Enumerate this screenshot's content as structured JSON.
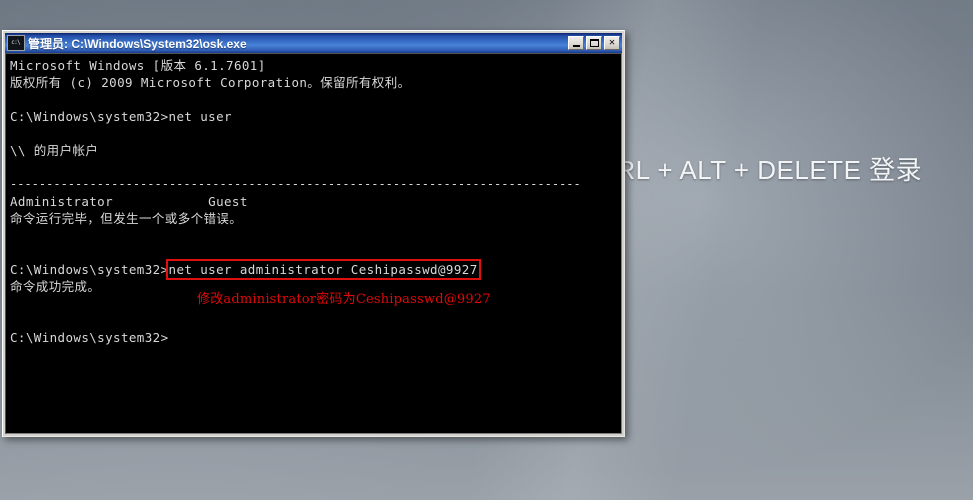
{
  "background": {
    "login_prompt": "TRL + ALT + DELETE 登录",
    "color": "#7c858f"
  },
  "window": {
    "title": "管理员: C:\\Windows\\System32\\osk.exe",
    "icon": "console-icon",
    "controls": {
      "minimize": "_",
      "maximize": "□",
      "close": "✕"
    }
  },
  "console": {
    "accent_red": "#e00808",
    "lines": [
      {
        "text": "Microsoft Windows [版本 6.1.7601]"
      },
      {
        "text": "版权所有 (c) 2009 Microsoft Corporation。保留所有权利。"
      },
      {
        "text": ""
      },
      {
        "text": "C:\\Windows\\system32>net user"
      },
      {
        "text": ""
      },
      {
        "text": "\\\\ 的用户帐户"
      },
      {
        "text": ""
      },
      {
        "text": "-------------------------------------------------------------------------------"
      },
      {
        "text": "Administrator            Guest"
      },
      {
        "text": "命令运行完毕，但发生一个或多个错误。"
      },
      {
        "text": ""
      },
      {
        "text": ""
      },
      {
        "prompt": "C:\\Windows\\system32>",
        "command": "net user administrator Ceshipasswd@9927",
        "highlight": true
      },
      {
        "text": "命令成功完成。"
      },
      {
        "text": ""
      },
      {
        "text": ""
      },
      {
        "text": "C:\\Windows\\system32>"
      }
    ],
    "annotation": "修改administrator密码为Ceshipasswd@9927"
  }
}
